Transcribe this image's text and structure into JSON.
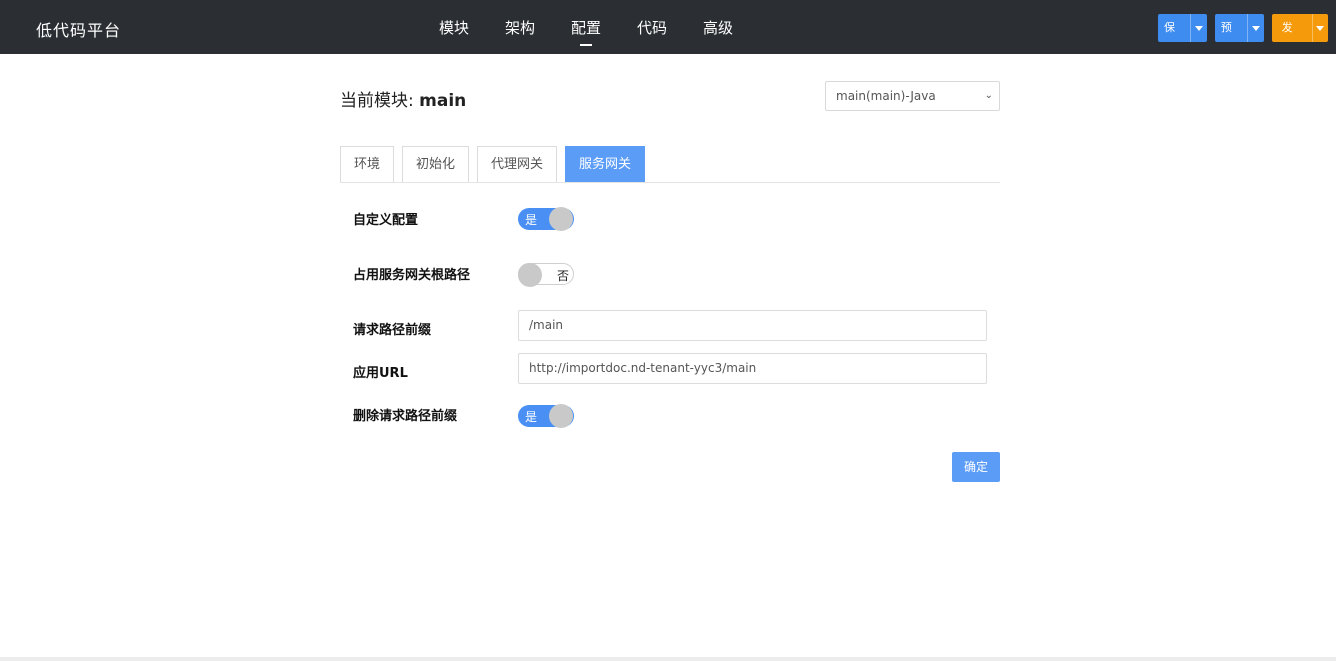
{
  "app": {
    "title": "低代码平台"
  },
  "nav": {
    "items": [
      "模块",
      "架构",
      "配置",
      "代码",
      "高级"
    ],
    "active": "配置"
  },
  "actions": {
    "save": "保存",
    "preview": "预览",
    "publish": "发布"
  },
  "module": {
    "prefix": "当前模块: ",
    "name": "main",
    "selected": "main(main)-Java"
  },
  "tabs": [
    "环境",
    "初始化",
    "代理网关",
    "服务网关"
  ],
  "active_tab": "服务网关",
  "form": {
    "custom_config": {
      "label": "自定义配置",
      "value": "是",
      "on": true
    },
    "occupy_root": {
      "label": "占用服务网关根路径",
      "value": "否",
      "on": false
    },
    "path_prefix": {
      "label": "请求路径前缀",
      "value": "/main"
    },
    "app_url": {
      "label": "应用URL",
      "value": "http://importdoc.nd-tenant-yyc3/main"
    },
    "strip_prefix": {
      "label": "删除请求路径前缀",
      "value": "是",
      "on": true
    }
  },
  "confirm": "确定",
  "colors": {
    "topbar": "#2b2f33",
    "accent": "#5b9cf7",
    "publish": "#f59a0a"
  }
}
